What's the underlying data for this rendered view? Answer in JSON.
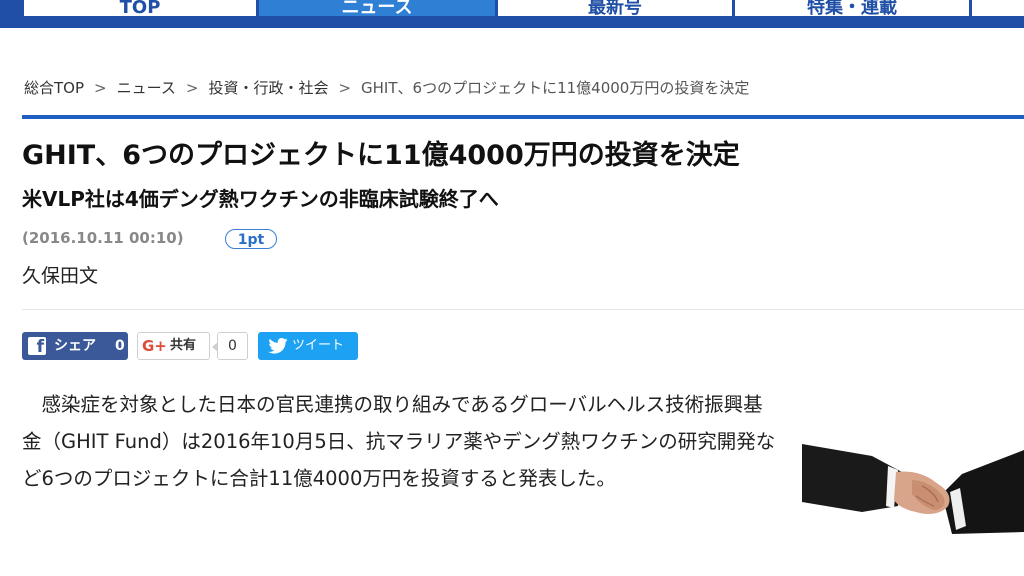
{
  "nav": {
    "tabs": [
      {
        "label": "TOP"
      },
      {
        "label": "ニュース"
      },
      {
        "label": "最新号"
      },
      {
        "label": "特集・連載"
      }
    ]
  },
  "breadcrumb": {
    "items": [
      "総合TOP",
      "ニュース",
      "投資・行政・社会"
    ],
    "separator": ">",
    "current": "GHIT、6つのプロジェクトに11億4000万円の投資を決定"
  },
  "article": {
    "title": "GHIT、6つのプロジェクトに11億4000万円の投資を決定",
    "subtitle": "米VLP社は4価デング熱ワクチンの非臨床試験終了へ",
    "date": "(2016.10.11 00:10)",
    "points_badge": "1pt",
    "author": "久保田文",
    "body": "感染症を対象とした日本の官民連携の取り組みであるグローバルヘルス技術振興基金（GHIT Fund）は2016年10月5日、抗マラリア薬やデング熱ワクチンの研究開発など6つのプロジェクトに合計11億4000万円を投資すると発表した。"
  },
  "share": {
    "facebook": {
      "label": "シェア",
      "count": "0",
      "icon": "facebook-icon"
    },
    "google_plus": {
      "label": "共有",
      "count": "0",
      "icon": "google-plus-icon"
    },
    "twitter": {
      "label": "ツイート",
      "icon": "twitter-bird-icon"
    }
  },
  "colors": {
    "nav_blue": "#1f4fa6",
    "active_tab": "#2f7fd4",
    "rule_blue": "#1f5fc4",
    "facebook": "#3b5998",
    "twitter": "#1da1f2"
  }
}
